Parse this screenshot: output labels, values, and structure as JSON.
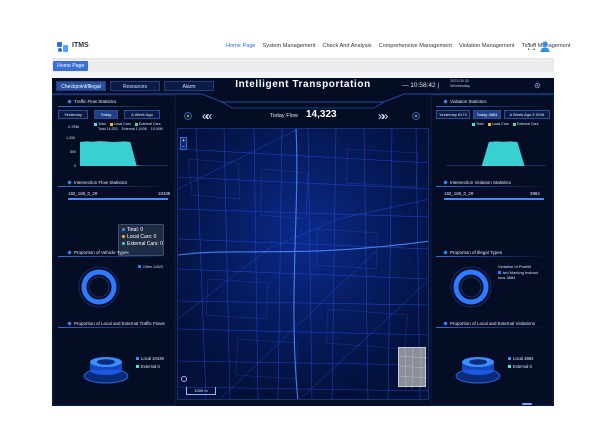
{
  "app": {
    "name": "ITMS"
  },
  "nav": {
    "items": [
      {
        "label": "Home Page",
        "active": true
      },
      {
        "label": "System Management",
        "active": false
      },
      {
        "label": "Check And Analysis",
        "active": false
      },
      {
        "label": "Comprehensive Management",
        "active": false
      },
      {
        "label": "Violation Management",
        "active": false
      },
      {
        "label": "Ticket Management",
        "active": false
      }
    ]
  },
  "page_tabs": [
    {
      "label": "Home Page"
    }
  ],
  "dashboard": {
    "tabs": [
      {
        "label": "Checkpoint/Illegal",
        "active": true
      },
      {
        "label": "Resources",
        "active": false
      },
      {
        "label": "Alarm",
        "active": false
      }
    ],
    "title": "Intelligent Transportation",
    "clock": "— 10:58:42 |",
    "date": "2023.05.31",
    "weekday": "Wednesday",
    "today_flow_label": "Today Flow",
    "today_flow_value": "14,323",
    "chevrons_left": "««",
    "chevrons_right": "»»"
  },
  "left": {
    "traffic_flow": {
      "title": "Traffic Flow Statistics",
      "buttons": [
        "Yesterday",
        "Today",
        "A Week Ago"
      ],
      "active_button": "Today",
      "legend": [
        "Total",
        "Local Cars",
        "External Cars"
      ],
      "legend_values": [
        "Total 14,323",
        "External 1,0436",
        "10.00M"
      ],
      "y_ticks": [
        "1,000",
        "500",
        "0"
      ],
      "top_value": "2.29M",
      "area": [
        0.8,
        0.82,
        0.81,
        0.83,
        0.82,
        0.8,
        0.81,
        0.82,
        0.8,
        0.02,
        0.0,
        0.0,
        0.0,
        0.0,
        0.0
      ]
    },
    "intersection": {
      "title": "Intersection Flow Statistics",
      "row_label": "192_168_0_29",
      "row_value": "10439"
    },
    "tooltip": {
      "rows": [
        {
          "label": "Total: 0",
          "color": "#3a8fff"
        },
        {
          "label": "Local Cars: 0",
          "color": "#f4b03a"
        },
        {
          "label": "External Cars: 0",
          "color": "#48d7a8"
        }
      ]
    },
    "vehicle_types": {
      "title": "Proportion of Vehicle Types",
      "legend": "Other 14323"
    },
    "local_external": {
      "title": "Proportion of Local and External Traffic Flows",
      "local": "Local  10439",
      "external": "External  0"
    }
  },
  "right": {
    "violation": {
      "title": "Violation Statistics",
      "buttons": [
        "Yesterday 8174",
        "Today 3884",
        "A Week Ago 5 9194"
      ],
      "active_button": "Today 3884",
      "legend": [
        "Total",
        "Local Cars",
        "External Cars"
      ],
      "area": [
        0.0,
        0.0,
        0.0,
        0.0,
        0.0,
        0.0,
        0.8,
        0.82,
        0.81,
        0.82,
        0.8,
        0.0,
        0.0,
        0.0,
        0.0
      ]
    },
    "intersection_violation": {
      "title": "Intersection Violation Statistics",
      "row_label": "192_168_0_29",
      "row_value": "3884"
    },
    "illegal_types": {
      "title": "Proportion of Illegal Types",
      "legend_l1": "Violation of Prohibi",
      "legend_l2": "ted Marking Instruct",
      "legend_l3": "ions 3884"
    },
    "local_external_violations": {
      "title": "Proportion of Local and External Violations",
      "local": "Local  3884",
      "external": "External  0"
    }
  },
  "map": {
    "scale_label": "1000 m",
    "zoom_in": "+",
    "zoom_out": "−"
  },
  "colors": {
    "accent": "#2f6bd8",
    "cyan": "#3ee6e6",
    "dash_bg": "#050d24"
  }
}
